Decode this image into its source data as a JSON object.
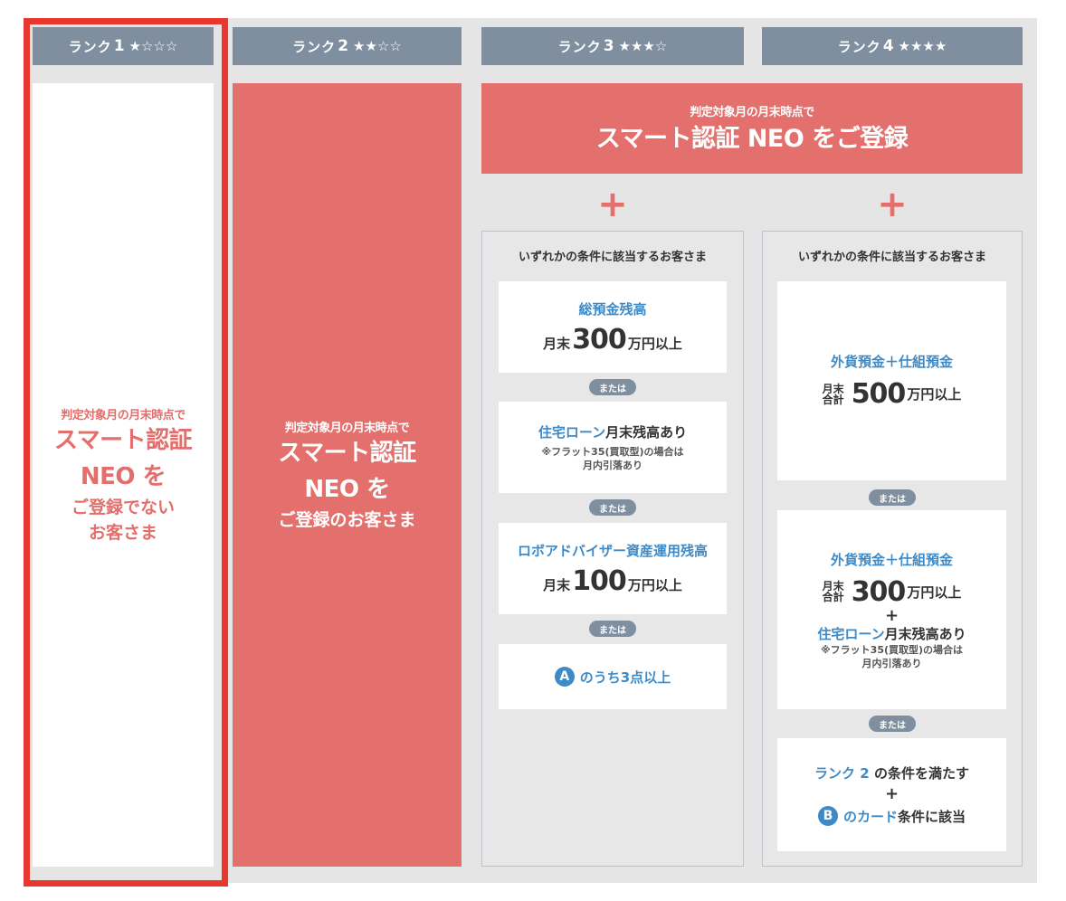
{
  "colors": {
    "header_bg": "#7f8fa0",
    "accent_red": "#e3706c",
    "link_blue": "#3d8ac7",
    "highlight_frame": "#e8372c",
    "panel_bg": "#e5e5e5"
  },
  "headers": [
    {
      "prefix": "ランク",
      "num": "1",
      "stars": "★☆☆☆"
    },
    {
      "prefix": "ランク",
      "num": "2",
      "stars": "★★☆☆"
    },
    {
      "prefix": "ランク",
      "num": "3",
      "stars": "★★★☆"
    },
    {
      "prefix": "ランク",
      "num": "4",
      "stars": "★★★★"
    }
  ],
  "rank1": {
    "line1": "判定対象月の月末時点で",
    "line2": "スマート認証",
    "line3": "NEO を",
    "line4": "ご登録でない",
    "line5": "お客さま"
  },
  "rank2": {
    "line1": "判定対象月の月末時点で",
    "line2": "スマート認証",
    "line3": "NEO を",
    "line4": "ご登録のお客さま"
  },
  "banner": {
    "line1": "判定対象月の月末時点で",
    "line2": "スマート認証 NEO をご登録"
  },
  "plus": "+",
  "or_label": "または",
  "rank3": {
    "title": "いずれかの条件に該当するお客さま",
    "c1_label": "総預金残高",
    "c1_pre": "月末",
    "c1_num": "300",
    "c1_unit": "万円以上",
    "c2_label_blue": "住宅ローン",
    "c2_label_black": "月末残高あり",
    "c2_note1": "※フラット35(買取型)の場合は",
    "c2_note2": "月内引落あり",
    "c3_label": "ロボアドバイザー資産運用残高",
    "c3_pre": "月末",
    "c3_num": "100",
    "c3_unit": "万円以上",
    "c4_badge": "A",
    "c4_text": "のうち3点以上"
  },
  "rank4": {
    "title": "いずれかの条件に該当するお客さま",
    "c1_label": "外貨預金＋仕組預金",
    "c1_pre_top": "月末",
    "c1_pre_bot": "合計",
    "c1_num": "500",
    "c1_unit": "万円以上",
    "c2_label": "外貨預金＋仕組預金",
    "c2_pre_top": "月末",
    "c2_pre_bot": "合計",
    "c2_num": "300",
    "c2_unit": "万円以上",
    "c2_plus": "+",
    "c2_loan_blue": "住宅ローン",
    "c2_loan_black": "月末残高あり",
    "c2_note1": "※フラット35(買取型)の場合は",
    "c2_note2": "月内引落あり",
    "c3_rank": "ランク 2",
    "c3_rank_rest": "の条件を満たす",
    "c3_plus": "+",
    "c3_badge": "B",
    "c3_card_blue": "のカード",
    "c3_card_black": "条件に該当"
  }
}
